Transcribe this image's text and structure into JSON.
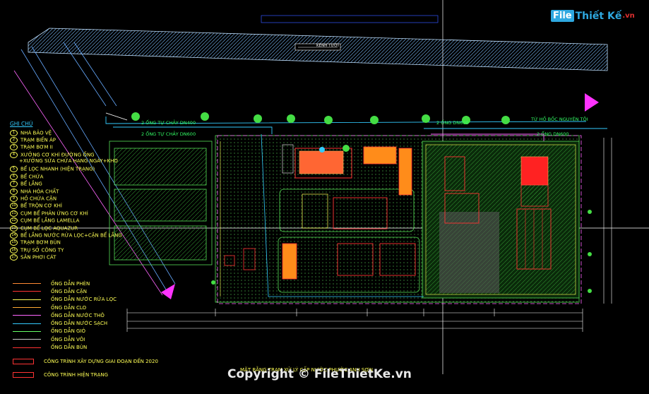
{
  "logo": {
    "brand_mark": "File",
    "brand_name": "Thiết Kế",
    "brand_tld": ".vn"
  },
  "drawing": {
    "canal_label": "KÊNH TƯỚI",
    "pipe_label_1": "2 ỐNG TỰ CHẢY DN400",
    "pipe_label_2": "2 ỐNG TỰ CHẢY DN600",
    "pipe_label_3": "2 ỐNG DN600",
    "pipe_label_4": "2 ỐNG DN600",
    "source_label": "TỪ HỒ BỐC NGUYÊN TÔI",
    "plan_title": "MẶT BẰNG TRẠM XỬ LÝ CẤP NƯỚC PHƯỚC ANH SƠN"
  },
  "legend": {
    "title": "GHI CHÚ",
    "items": [
      {
        "num": "1",
        "label": "NHÀ BẢO VỆ"
      },
      {
        "num": "2",
        "label": "TRẠM BIẾN ÁP"
      },
      {
        "num": "3",
        "label": "TRẠM BƠM II"
      },
      {
        "num": "4",
        "label": "XƯỞNG CƠ KHÍ ĐƯỜNG ỐNG"
      },
      {
        "num": "",
        "label": "+XƯỞNG SỬA CHỮA HẠNG NGÀY+KHO"
      },
      {
        "num": "5",
        "label": "BỂ LỌC NHANH (HIỆN TRẠNG)"
      },
      {
        "num": "6",
        "label": "BỂ CHỨA"
      },
      {
        "num": "7",
        "label": "BỂ LẮNG"
      },
      {
        "num": "8",
        "label": "NHÀ HÓA CHẤT"
      },
      {
        "num": "9",
        "label": "HỒ CHỨA CẶN"
      },
      {
        "num": "10",
        "label": "BỂ TRỘN CƠ KHÍ"
      },
      {
        "num": "11",
        "label": "CỤM BỂ PHẢN ỨNG CƠ KHÍ"
      },
      {
        "num": "12",
        "label": "CỤM BỂ LẮNG LAMELLA"
      },
      {
        "num": "13",
        "label": "CỤM BỂ LỌC AQUAZUR"
      },
      {
        "num": "14",
        "label": "BỂ LẮNG NƯỚC RỬA LỌC+CẶN BỂ LẮNG"
      },
      {
        "num": "15",
        "label": "TRẠM BƠM BÙN"
      },
      {
        "num": "16",
        "label": "TRỤ SỞ CÔNG TY"
      },
      {
        "num": "17",
        "label": "SÂN PHƠI CÁT"
      }
    ]
  },
  "pipes": [
    {
      "label": "ỐNG DẪN PHÈN",
      "color": "#ff8833"
    },
    {
      "label": "ỐNG DẪN CẶN",
      "color": "#ff3333"
    },
    {
      "label": "ỐNG DẪN NƯỚC RỬA LỌC",
      "color": "#ffff55"
    },
    {
      "label": "ỐNG DẪN CLO",
      "color": "#ffaa33"
    },
    {
      "label": "ỐNG DẪN NƯỚC THÔ",
      "color": "#ff66ff"
    },
    {
      "label": "ỐNG DẪN NƯỚC SẠCH",
      "color": "#33ccff"
    },
    {
      "label": "ỐNG DẪN GIÓ",
      "color": "#66ff66"
    },
    {
      "label": "ỐNG DẪN VÔI",
      "color": "#cccccc"
    },
    {
      "label": "ỐNG DẪN BÙN",
      "color": "#ff3333"
    }
  ],
  "marks": [
    {
      "label": "CÔNG TRÌNH XÂY DỰNG GIAI ĐOẠN ĐẾN 2020"
    },
    {
      "label": "CÔNG TRÌNH HIỆN TRẠNG"
    }
  ],
  "watermark": "Copyright © FileThietKe.vn",
  "colors": {
    "background": "#000000",
    "site_green": "#1f6f1f",
    "building_red": "#ff3333",
    "building_orange": "#ff8c1a",
    "pipe_cyan": "#33ccff"
  }
}
